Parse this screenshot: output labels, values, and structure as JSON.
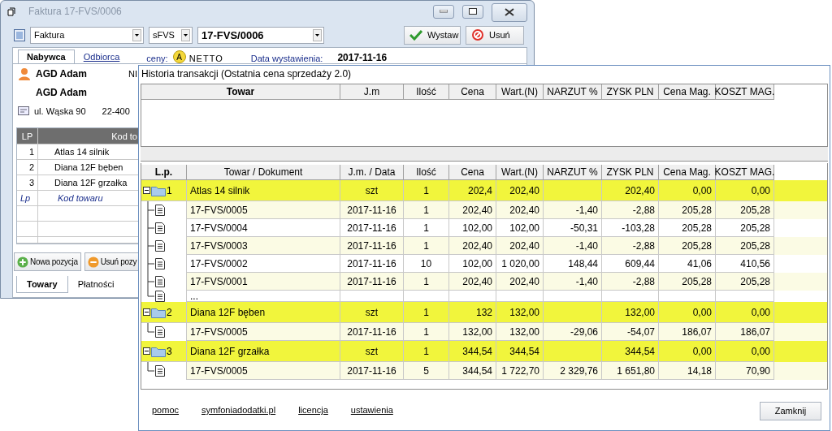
{
  "invoice_window": {
    "title": "Faktura 17-FVS/0006",
    "doc_type": "Faktura",
    "series": "sFVS",
    "number": "17-FVS/0006",
    "buttons": [
      {
        "label": "Wystaw",
        "kind": "issue"
      },
      {
        "label": "Usuń",
        "kind": "delete"
      }
    ],
    "tabs": [
      {
        "label": "Nabywca",
        "selected": true
      },
      {
        "label": "Odbiorca",
        "selected": false
      }
    ],
    "prices_label": "ceny:",
    "prices_badge": "A",
    "prices_mode": "NETTO",
    "date_label": "Data wystawienia:",
    "date": "2017-11-16",
    "buyer": {
      "name": "AGD Adam",
      "nip_label": "NI",
      "name_2": "AGD Adam",
      "street": "ul. Wąska 90",
      "postcode": "22-400"
    },
    "items": {
      "columns": [
        "LP",
        "Kod to"
      ],
      "rows": [
        {
          "lp": "1",
          "name": "Atlas 14 silnik"
        },
        {
          "lp": "2",
          "name": "Diana 12F bęben"
        },
        {
          "lp": "3",
          "name": "Diana 12F grzałka"
        }
      ],
      "new_row": {
        "lp": "Lp",
        "name": "Kod towaru"
      }
    },
    "item_buttons": [
      {
        "label": "Nowa pozycja",
        "kind": "add"
      },
      {
        "label": "Usuń pozy",
        "kind": "remove"
      }
    ],
    "bottom_tabs": [
      {
        "label": "Towary",
        "selected": true
      },
      {
        "label": "Płatności",
        "selected": false
      }
    ]
  },
  "history_window": {
    "title": "Historia transakcji (Ostatnia cena sprzedaży 2.0)",
    "top_columns": [
      "Towar",
      "J.m",
      "Ilość",
      "Cena",
      "Wart.(N)",
      "NARZUT %",
      "ZYSK PLN",
      "Cena Mag.",
      "KOSZT MAG."
    ],
    "columns": [
      "L.p.",
      "Towar / Dokument",
      "J.m. / Data",
      "Ilość",
      "Cena",
      "Wart.(N)",
      "NARZUT %",
      "ZYSK PLN",
      "Cena Mag.",
      "KOSZT MAG."
    ],
    "groups": [
      {
        "lp": "1",
        "name": "Atlas 14 silnik",
        "unit": "szt",
        "qty": "1",
        "price": "202,4",
        "value": "202,40",
        "profit": "202,40",
        "stock_price": "0,00",
        "stock_cost": "0,00",
        "expanded": true,
        "children": [
          {
            "document": "17-FVS/0005",
            "date": "2017-11-16",
            "qty": "1",
            "price": "202,40",
            "value": "202,40",
            "markup": "-1,40",
            "profit": "-2,88",
            "stock_price": "205,28",
            "stock_cost": "205,28"
          },
          {
            "document": "17-FVS/0004",
            "date": "2017-11-16",
            "qty": "1",
            "price": "102,00",
            "value": "102,00",
            "markup": "-50,31",
            "profit": "-103,28",
            "stock_price": "205,28",
            "stock_cost": "205,28"
          },
          {
            "document": "17-FVS/0003",
            "date": "2017-11-16",
            "qty": "1",
            "price": "202,40",
            "value": "202,40",
            "markup": "-1,40",
            "profit": "-2,88",
            "stock_price": "205,28",
            "stock_cost": "205,28"
          },
          {
            "document": "17-FVS/0002",
            "date": "2017-11-16",
            "qty": "10",
            "price": "102,00",
            "value": "1 020,00",
            "markup": "148,44",
            "profit": "609,44",
            "stock_price": "41,06",
            "stock_cost": "410,56"
          },
          {
            "document": "17-FVS/0001",
            "date": "2017-11-16",
            "qty": "1",
            "price": "202,40",
            "value": "202,40",
            "markup": "-1,40",
            "profit": "-2,88",
            "stock_price": "205,28",
            "stock_cost": "205,28"
          },
          {
            "document": "..."
          }
        ]
      },
      {
        "lp": "2",
        "name": "Diana 12F bęben",
        "unit": "szt",
        "qty": "1",
        "price": "132",
        "value": "132,00",
        "profit": "132,00",
        "stock_price": "0,00",
        "stock_cost": "0,00",
        "expanded": true,
        "children": [
          {
            "document": "17-FVS/0005",
            "date": "2017-11-16",
            "qty": "1",
            "price": "132,00",
            "value": "132,00",
            "markup": "-29,06",
            "profit": "-54,07",
            "stock_price": "186,07",
            "stock_cost": "186,07"
          }
        ]
      },
      {
        "lp": "3",
        "name": "Diana 12F grzałka",
        "unit": "szt",
        "qty": "1",
        "price": "344,54",
        "value": "344,54",
        "profit": "344,54",
        "stock_price": "0,00",
        "stock_cost": "0,00",
        "expanded": true,
        "children": [
          {
            "document": "17-FVS/0005",
            "date": "2017-11-16",
            "qty": "5",
            "price": "344,54",
            "value": "1 722,70",
            "markup": "2 329,76",
            "profit": "1 651,80",
            "stock_price": "14,18",
            "stock_cost": "70,90"
          }
        ]
      }
    ],
    "links": [
      "pomoc",
      "symfoniadodatki.pl",
      "licencja",
      "ustawienia"
    ],
    "close_button": "Zamknij"
  }
}
